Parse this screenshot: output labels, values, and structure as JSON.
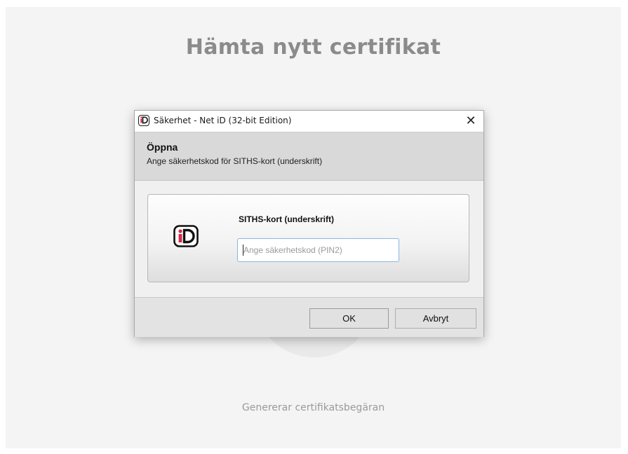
{
  "page": {
    "title": "Hämta nytt certifikat",
    "status": "Genererar certifikatsbegäran"
  },
  "dialog": {
    "window_title": "Säkerhet - Net iD (32-bit Edition)",
    "close_glyph": "✕",
    "heading": "Öppna",
    "subheading": "Ange säkerhetskod för SITHS-kort (underskrift)",
    "card": {
      "label": "SITHS-kort (underskrift)",
      "logo_icon": "net-id-logo-icon",
      "pin_input": {
        "value": "",
        "placeholder": "Ange säkerhetskod (PIN2)"
      }
    },
    "buttons": {
      "ok": "OK",
      "cancel": "Avbryt"
    }
  },
  "colors": {
    "accent": "#d62a4a",
    "input_focus_border": "#8ab4e6",
    "page_bg": "#f4f4f4"
  }
}
